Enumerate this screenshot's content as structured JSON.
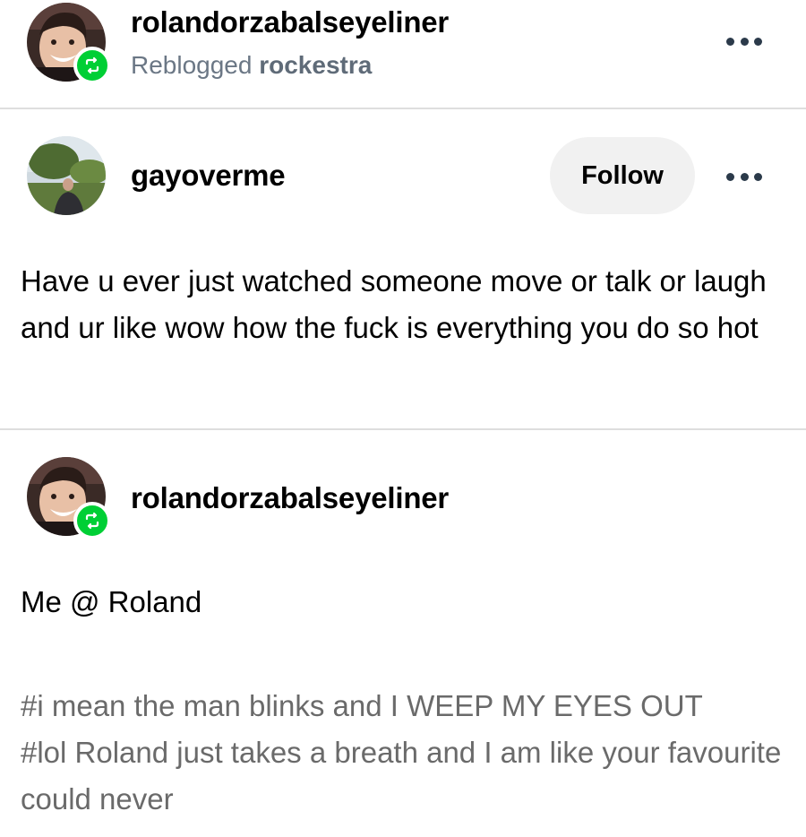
{
  "reblog_header": {
    "username": "rolandorzabalseyeliner",
    "reblogged_prefix": "Reblogged",
    "reblogged_from": "rockestra",
    "avatar_icon": "person-smiling-avatar",
    "badge_icon": "reblog-icon",
    "more_icon": "more-options-icon"
  },
  "original_post": {
    "username": "gayoverme",
    "follow_label": "Follow",
    "avatar_icon": "outdoor-person-avatar",
    "more_icon": "more-options-icon",
    "text": "Have u ever just watched someone move or talk or laugh and ur like wow how the fuck is everything you do so hot"
  },
  "reblog_post": {
    "username": "rolandorzabalseyeliner",
    "avatar_icon": "person-smiling-avatar",
    "badge_icon": "reblog-icon",
    "text": "Me @ Roland",
    "tags": [
      "#i mean the man blinks and I WEEP MY EYES OUT",
      "#lol Roland just takes a breath and I am like your favourite could never"
    ]
  },
  "colors": {
    "reblog_green": "#00cf35",
    "divider": "#dedede",
    "follow_bg": "#f1f1f1",
    "secondary_text": "#6b7785",
    "tag_text": "#6a6a6a"
  }
}
